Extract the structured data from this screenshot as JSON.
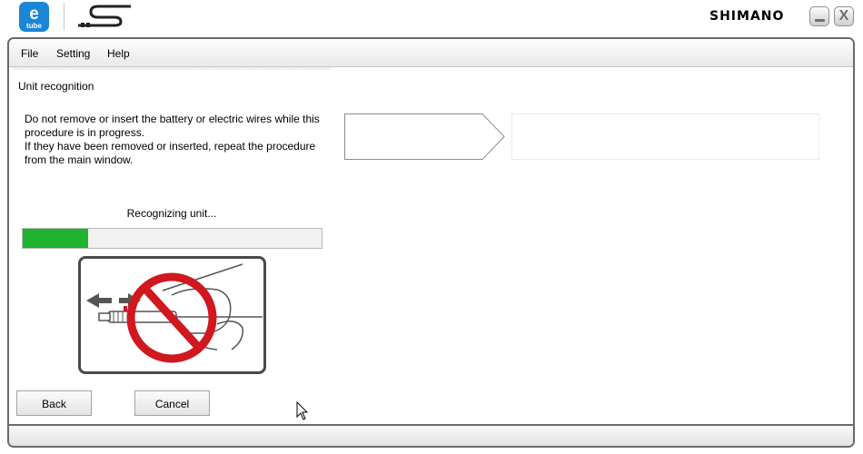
{
  "titlebar": {
    "logo_top": "e",
    "logo_bottom": "tube",
    "brand": "SHIMANO",
    "minimize_icon": "minimize-icon",
    "close_label": "X"
  },
  "menu": [
    {
      "label": "File"
    },
    {
      "label": "Setting"
    },
    {
      "label": "Help"
    }
  ],
  "page": {
    "title": "Unit recognition",
    "warning": "Do not remove or insert the battery or electric wires while this procedure is in progress.\nIf they have been removed or inserted, repeat the procedure from the main window.",
    "status": "Recognizing unit...",
    "progress": 0.22,
    "illustration_icon": "no-unplug-battery-icon"
  },
  "buttons": {
    "back": "Back",
    "cancel": "Cancel"
  },
  "colors": {
    "progress_fill": "#1fb32e",
    "etube_blue": "#1a86d6",
    "prohibit_red": "#d0181e"
  }
}
